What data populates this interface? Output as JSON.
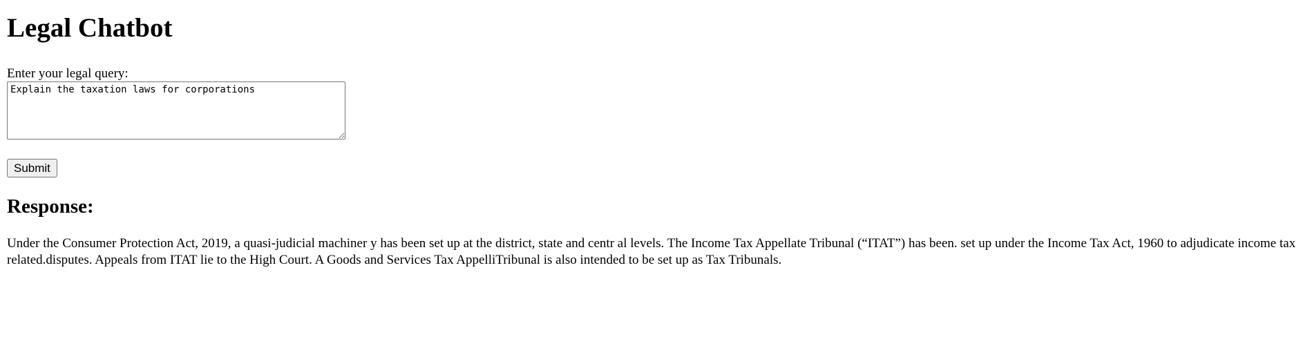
{
  "page": {
    "title": "Legal Chatbot"
  },
  "query": {
    "label": "Enter your legal query:",
    "value": "Explain the taxation laws for corporations"
  },
  "actions": {
    "submit_label": "Submit"
  },
  "response": {
    "heading": "Response:",
    "text": "Under the Consumer Protection Act, 2019, a quasi-judicial machiner y has been set up at the district, state and centr al levels. The Income Tax Appellate Tribunal (“ITAT”) has been. set up under the Income Tax Act, 1960 to adjudicate income tax related.disputes. Appeals from ITAT lie to the High Court. A Goods and Services Tax AppelliTribunal is also intended to be set up as Tax Tribunals."
  }
}
